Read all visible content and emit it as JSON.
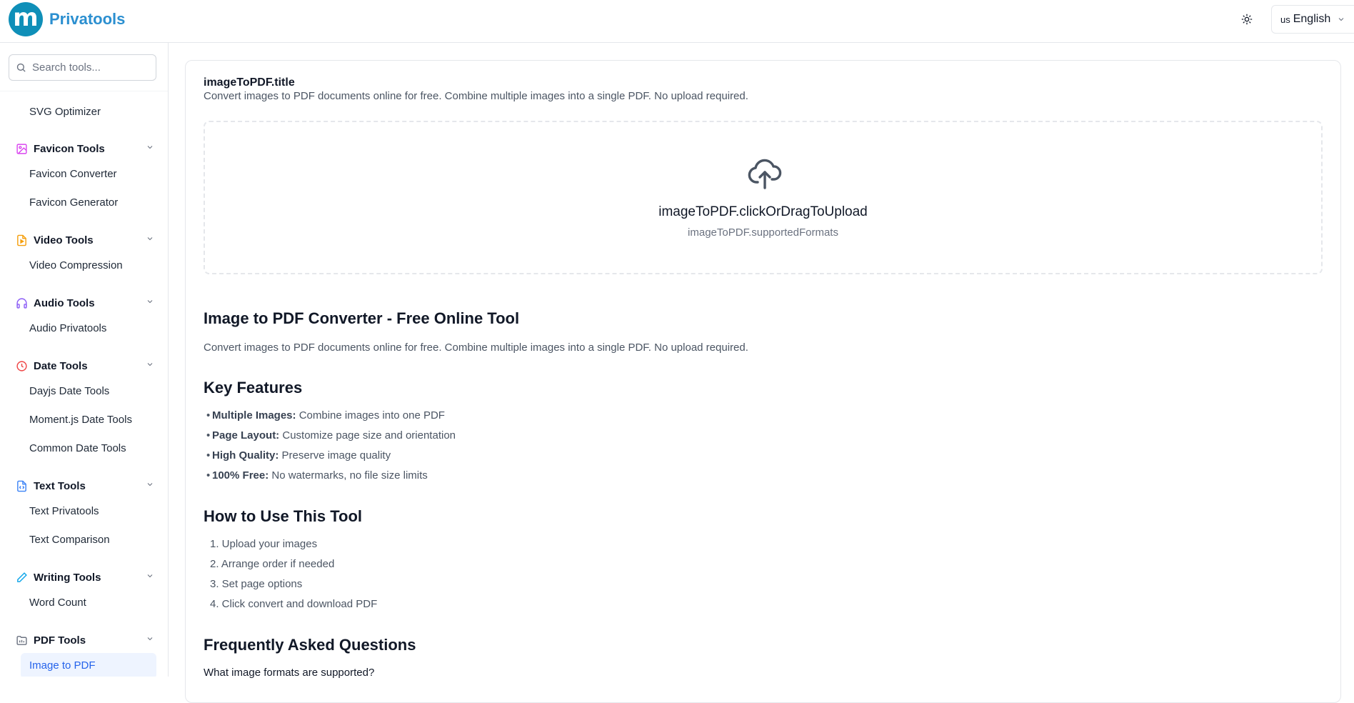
{
  "header": {
    "brand": "Privatools",
    "logo_letter": "m",
    "language_flag": "us",
    "language": "English"
  },
  "sidebar": {
    "search_placeholder": "Search tools...",
    "top_item": "SVG Optimizer",
    "groups": [
      {
        "label": "Favicon Tools",
        "icon": "image-icon",
        "color": "#d946ef",
        "items": [
          "Favicon Converter",
          "Favicon Generator"
        ]
      },
      {
        "label": "Video Tools",
        "icon": "video-file-icon",
        "color": "#f59e0b",
        "items": [
          "Video Compression"
        ]
      },
      {
        "label": "Audio Tools",
        "icon": "headphones-icon",
        "color": "#8b5cf6",
        "items": [
          "Audio Privatools"
        ]
      },
      {
        "label": "Date Tools",
        "icon": "clock-icon",
        "color": "#ef4444",
        "items": [
          "Dayjs Date Tools",
          "Moment.js Date Tools",
          "Common Date Tools"
        ]
      },
      {
        "label": "Text Tools",
        "icon": "code-file-icon",
        "color": "#3b82f6",
        "items": [
          "Text Privatools",
          "Text Comparison"
        ]
      },
      {
        "label": "Writing Tools",
        "icon": "pencil-icon",
        "color": "#0ea5e9",
        "items": [
          "Word Count"
        ]
      },
      {
        "label": "PDF Tools",
        "icon": "pdf-folder-icon",
        "color": "#6b7280",
        "items": [
          "Image to PDF"
        ]
      }
    ],
    "active_item": "Image to PDF"
  },
  "main": {
    "title": "imageToPDF.title",
    "subtitle": "Convert images to PDF documents online for free. Combine multiple images into a single PDF. No upload required.",
    "dropzone": {
      "title": "imageToPDF.clickOrDragToUpload",
      "subtitle": "imageToPDF.supportedFormats"
    },
    "intro_heading": "Image to PDF Converter - Free Online Tool",
    "intro_text": "Convert images to PDF documents online for free. Combine multiple images into a single PDF. No upload required.",
    "features_heading": "Key Features",
    "features": [
      {
        "bold": "Multiple Images:",
        "text": " Combine images into one PDF"
      },
      {
        "bold": "Page Layout:",
        "text": " Customize page size and orientation"
      },
      {
        "bold": "High Quality:",
        "text": " Preserve image quality"
      },
      {
        "bold": "100% Free:",
        "text": " No watermarks, no file size limits"
      }
    ],
    "howto_heading": "How to Use This Tool",
    "steps": [
      "1. Upload your images",
      "2. Arrange order if needed",
      "3. Set page options",
      "4. Click convert and download PDF"
    ],
    "faq_heading": "Frequently Asked Questions",
    "faq_first_question": "What image formats are supported?"
  },
  "colors": {
    "brand": "#2b8fd0",
    "active_bg": "#eef4ff",
    "active_text": "#2563eb"
  }
}
